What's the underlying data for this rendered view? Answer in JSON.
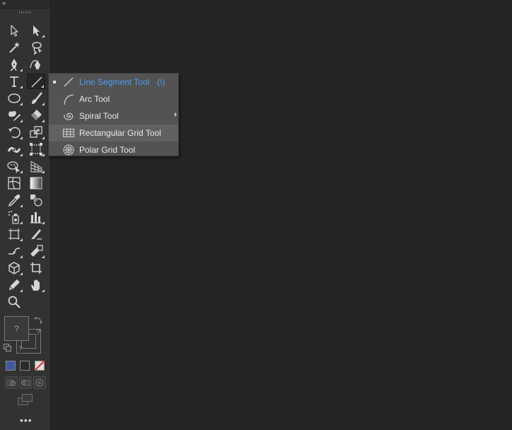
{
  "toolbar": {
    "collapse_label": "‹‹",
    "tools": [
      {
        "name": "selection-tool",
        "icon": "selection-arrow-icon",
        "col": 0,
        "row": 0,
        "has_submenu": false
      },
      {
        "name": "direct-selection-tool",
        "icon": "direct-selection-arrow-icon",
        "col": 1,
        "row": 0,
        "has_submenu": true
      },
      {
        "name": "magic-wand-tool",
        "icon": "magic-wand-icon",
        "col": 0,
        "row": 1,
        "has_submenu": false
      },
      {
        "name": "lasso-tool",
        "icon": "lasso-icon",
        "col": 1,
        "row": 1,
        "has_submenu": false
      },
      {
        "name": "pen-tool",
        "icon": "pen-nib-icon",
        "col": 0,
        "row": 2,
        "has_submenu": true
      },
      {
        "name": "curvature-tool",
        "icon": "curvature-pen-icon",
        "col": 1,
        "row": 2,
        "has_submenu": false
      },
      {
        "name": "type-tool",
        "icon": "type-t-icon",
        "col": 0,
        "row": 3,
        "has_submenu": true
      },
      {
        "name": "line-segment-tool",
        "icon": "line-segment-icon",
        "col": 1,
        "row": 3,
        "has_submenu": true,
        "active": true
      },
      {
        "name": "ellipse-tool",
        "icon": "ellipse-icon",
        "col": 0,
        "row": 4,
        "has_submenu": true
      },
      {
        "name": "paintbrush-tool",
        "icon": "paintbrush-icon",
        "col": 1,
        "row": 4,
        "has_submenu": true
      },
      {
        "name": "shaper-tool",
        "icon": "shaper-icon",
        "col": 0,
        "row": 5,
        "has_submenu": true
      },
      {
        "name": "eraser-tool",
        "icon": "eraser-icon",
        "col": 1,
        "row": 5,
        "has_submenu": true
      },
      {
        "name": "rotate-tool",
        "icon": "rotate-icon",
        "col": 0,
        "row": 6,
        "has_submenu": true
      },
      {
        "name": "scale-tool",
        "icon": "scale-icon",
        "col": 1,
        "row": 6,
        "has_submenu": true
      },
      {
        "name": "width-tool",
        "icon": "width-icon",
        "col": 0,
        "row": 7,
        "has_submenu": true
      },
      {
        "name": "free-transform-tool",
        "icon": "free-transform-icon",
        "col": 1,
        "row": 7,
        "has_submenu": true
      },
      {
        "name": "shape-builder-tool",
        "icon": "shape-builder-icon",
        "col": 0,
        "row": 8,
        "has_submenu": true
      },
      {
        "name": "perspective-grid-tool",
        "icon": "perspective-grid-icon",
        "col": 1,
        "row": 8,
        "has_submenu": true
      },
      {
        "name": "mesh-tool",
        "icon": "mesh-icon",
        "col": 0,
        "row": 9,
        "has_submenu": false
      },
      {
        "name": "gradient-tool",
        "icon": "gradient-icon",
        "col": 1,
        "row": 9,
        "has_submenu": false
      },
      {
        "name": "eyedropper-tool",
        "icon": "eyedropper-icon",
        "col": 0,
        "row": 10,
        "has_submenu": true
      },
      {
        "name": "blend-tool",
        "icon": "blend-icon",
        "col": 1,
        "row": 10,
        "has_submenu": false
      },
      {
        "name": "symbol-sprayer-tool",
        "icon": "symbol-sprayer-icon",
        "col": 0,
        "row": 11,
        "has_submenu": true
      },
      {
        "name": "column-graph-tool",
        "icon": "column-graph-icon",
        "col": 1,
        "row": 11,
        "has_submenu": true
      },
      {
        "name": "artboard-tool",
        "icon": "artboard-icon",
        "col": 0,
        "row": 12,
        "has_submenu": true
      },
      {
        "name": "slice-tool",
        "icon": "slice-icon",
        "col": 1,
        "row": 12,
        "has_submenu": false
      },
      {
        "name": "join-tool",
        "icon": "join-icon",
        "col": 0,
        "row": 13,
        "has_submenu": true
      },
      {
        "name": "live-paint-selection-tool",
        "icon": "live-paint-icon",
        "col": 1,
        "row": 13,
        "has_submenu": true
      },
      {
        "name": "3d-tool",
        "icon": "cube-icon",
        "col": 0,
        "row": 14,
        "has_submenu": true
      },
      {
        "name": "crop-image-tool",
        "icon": "crop-icon",
        "col": 1,
        "row": 14,
        "has_submenu": false
      },
      {
        "name": "pencil-tool",
        "icon": "pencil-icon",
        "col": 0,
        "row": 15,
        "has_submenu": true
      },
      {
        "name": "hand-tool",
        "icon": "hand-icon",
        "col": 1,
        "row": 15,
        "has_submenu": true
      },
      {
        "name": "zoom-tool",
        "icon": "zoom-magnifier-icon",
        "col": 0,
        "row": 16,
        "has_submenu": false
      }
    ],
    "fill_label": "?",
    "stroke_label_1": "?",
    "stroke_label_2": "?",
    "mode_colors": {
      "color": "#3d5a9e",
      "none_slash": "#e0322e"
    },
    "more_label": "•••"
  },
  "flyout": {
    "items": [
      {
        "label": "Line Segment Tool",
        "shortcut": "(\\)",
        "icon": "line-segment-icon",
        "selected": true
      },
      {
        "label": "Arc Tool",
        "icon": "arc-icon"
      },
      {
        "label": "Spiral Tool",
        "icon": "spiral-icon"
      },
      {
        "label": "Rectangular Grid Tool",
        "icon": "rectangular-grid-icon",
        "hovered": true
      },
      {
        "label": "Polar Grid Tool",
        "icon": "polar-grid-icon"
      }
    ],
    "accent_color": "#4b9cf0"
  }
}
